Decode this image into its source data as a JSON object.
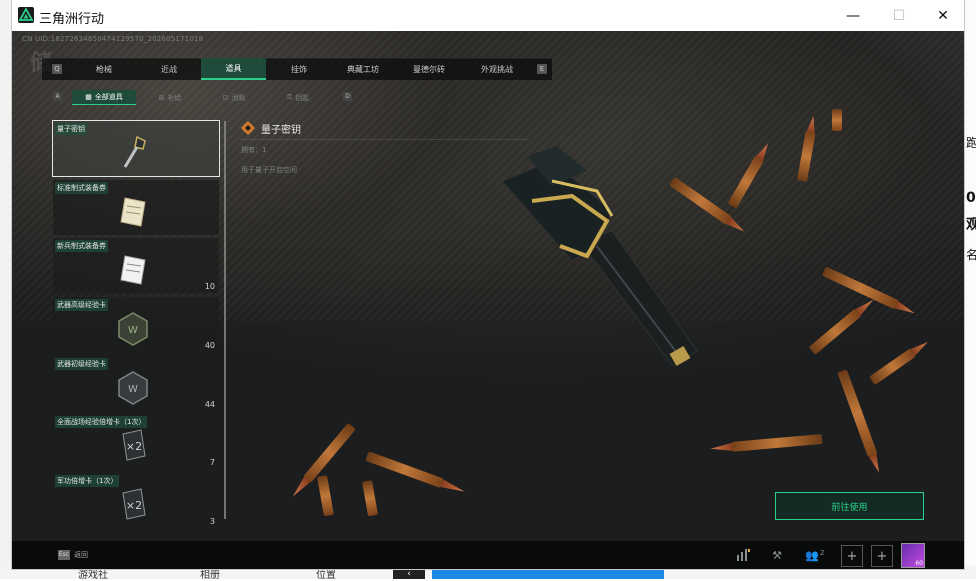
{
  "window": {
    "title": "三角洲行动",
    "min_symbol": "—",
    "max_symbol": "☐",
    "close_symbol": "✕"
  },
  "game": {
    "uid": "CN UID:18272634650474129570_202605171018",
    "tabs": [
      "枪械",
      "近战",
      "道具",
      "挂饰",
      "典藏工坊",
      "曼德尔砖",
      "外观挑战"
    ],
    "active_tab": "道具",
    "tab_key_left": "Q",
    "tab_key_right": "E",
    "subtabs": [
      "全部道具",
      "补给",
      "消耗",
      "钥匙"
    ],
    "sub_key_left": "A",
    "sub_key_right": "D",
    "items": [
      {
        "name": "量子密钥",
        "count": ""
      },
      {
        "name": "标准制式装备券",
        "count": ""
      },
      {
        "name": "新兵制式装备券",
        "count": "10"
      },
      {
        "name": "武器高级经验卡",
        "count": "40"
      },
      {
        "name": "武器初级经验卡",
        "count": "44"
      },
      {
        "name": "全面战场经验倍增卡（1次）",
        "count": "7"
      },
      {
        "name": "军功倍增卡（1次）",
        "count": "3"
      }
    ],
    "detail": {
      "title": "量子密钥",
      "line1": "拥有：1",
      "line2": "用于量子开启空间"
    },
    "use_button": "前往使用",
    "esc_key": "Esc",
    "esc_label": "返回",
    "friends_count": "2",
    "avatar_level": "60",
    "colors": {
      "accent": "#2bd08a",
      "active_tab_bg": "#1f4b3b"
    }
  },
  "background": {
    "bottom_texts": [
      "游戏社",
      "相册",
      "位置"
    ],
    "side_chars": [
      "0",
      "观",
      "名",
      "跑"
    ]
  }
}
